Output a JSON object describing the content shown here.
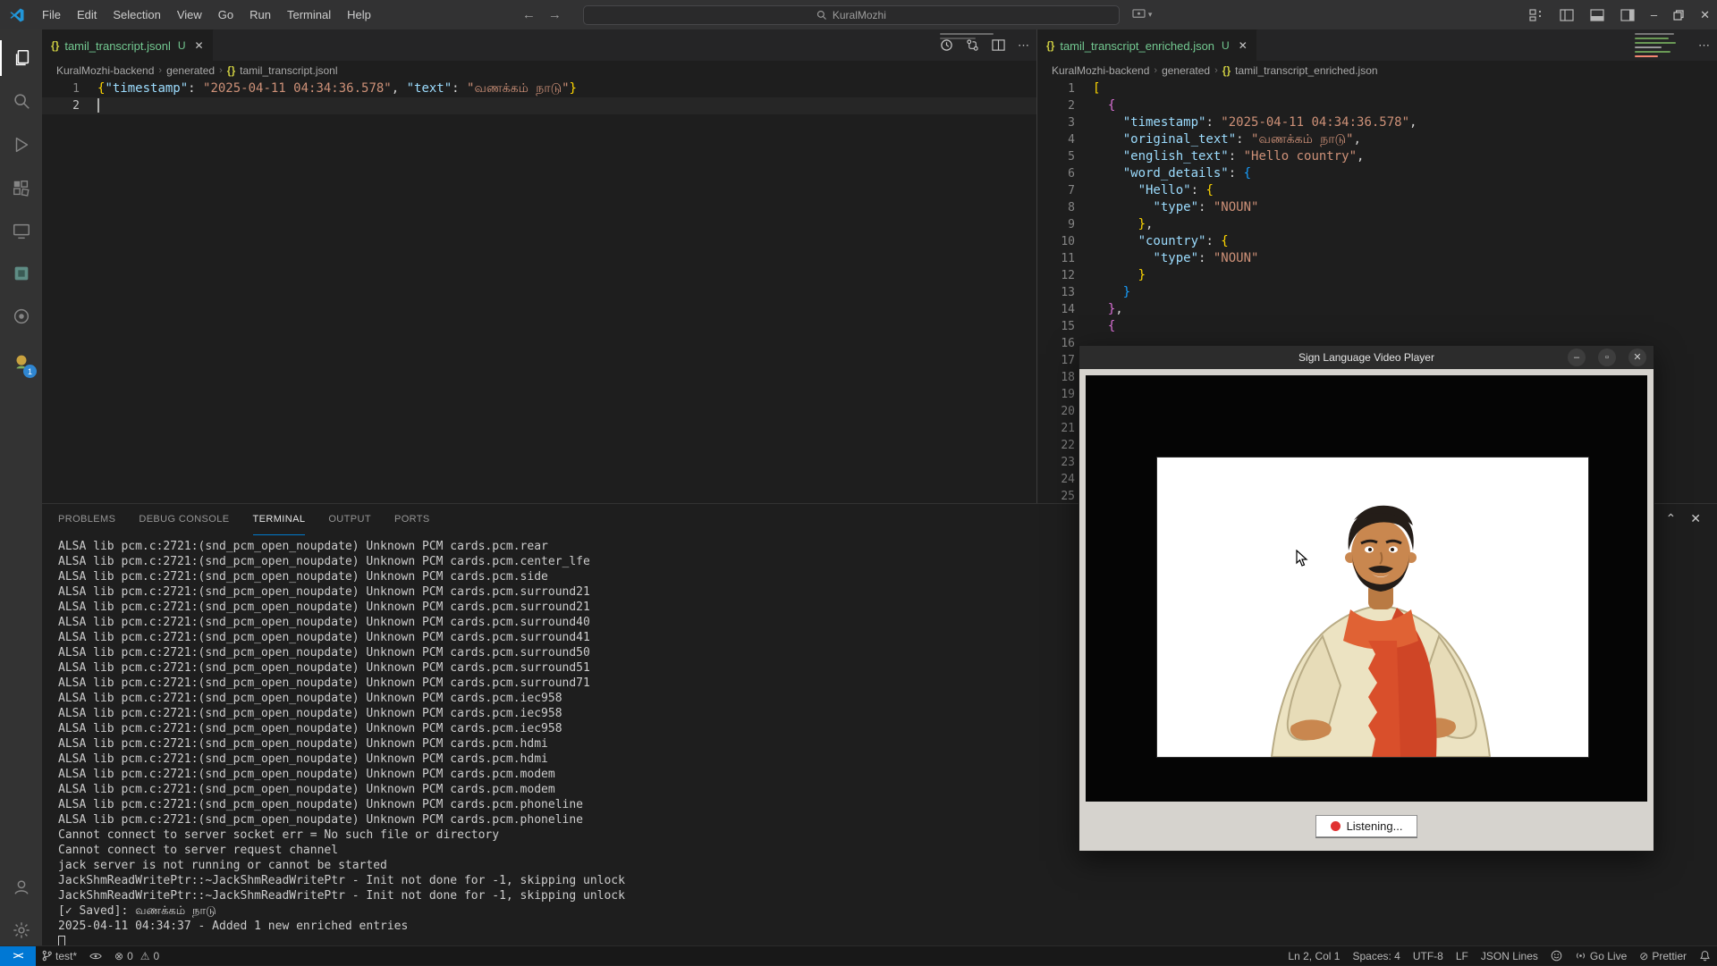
{
  "colors": {
    "accent": "#007acc",
    "untracked_green": "#73c991",
    "badge_blue": "#2f86d1",
    "listening_red": "#e03131",
    "json_icon_yellow": "#cbcb41"
  },
  "titlebar": {
    "menus": [
      "File",
      "Edit",
      "Selection",
      "View",
      "Go",
      "Run",
      "Terminal",
      "Help"
    ],
    "search_value": "KuralMozhi"
  },
  "activity_bar": {
    "badge": "1"
  },
  "editors": {
    "left": {
      "tab_label": "tamil_transcript.jsonl",
      "git_status": "U",
      "close_glyph": "✕",
      "breadcrumb": [
        "KuralMozhi-backend",
        "generated",
        "tamil_transcript.jsonl"
      ],
      "total_lines": 2,
      "cursor_line": 2,
      "lines": {
        "1": [
          [
            "b1",
            "{"
          ],
          [
            "k",
            "\"timestamp\""
          ],
          [
            "p",
            ": "
          ],
          [
            "s",
            "\"2025-04-11 04:34:36.578\""
          ],
          [
            "p",
            ", "
          ],
          [
            "k",
            "\"text\""
          ],
          [
            "p",
            ": "
          ],
          [
            "s",
            "\"வணக்கம் நாடு\""
          ],
          [
            "b1",
            "}"
          ]
        ]
      }
    },
    "right": {
      "tab_label": "tamil_transcript_enriched.json",
      "git_status": "U",
      "close_glyph": "✕",
      "breadcrumb": [
        "KuralMozhi-backend",
        "generated",
        "tamil_transcript_enriched.json"
      ],
      "total_lines": 25,
      "lines": {
        "1": [
          [
            "b1",
            "["
          ]
        ],
        "2": [
          [
            "p",
            "  "
          ],
          [
            "b2",
            "{"
          ]
        ],
        "3": [
          [
            "p",
            "    "
          ],
          [
            "k",
            "\"timestamp\""
          ],
          [
            "p",
            ": "
          ],
          [
            "s",
            "\"2025-04-11 04:34:36.578\""
          ],
          [
            "p",
            ","
          ]
        ],
        "4": [
          [
            "p",
            "    "
          ],
          [
            "k",
            "\"original_text\""
          ],
          [
            "p",
            ": "
          ],
          [
            "s",
            "\"வணக்கம் நாடு\""
          ],
          [
            "p",
            ","
          ]
        ],
        "5": [
          [
            "p",
            "    "
          ],
          [
            "k",
            "\"english_text\""
          ],
          [
            "p",
            ": "
          ],
          [
            "s",
            "\"Hello country\""
          ],
          [
            "p",
            ","
          ]
        ],
        "6": [
          [
            "p",
            "    "
          ],
          [
            "k",
            "\"word_details\""
          ],
          [
            "p",
            ": "
          ],
          [
            "b3",
            "{"
          ]
        ],
        "7": [
          [
            "p",
            "      "
          ],
          [
            "k",
            "\"Hello\""
          ],
          [
            "p",
            ": "
          ],
          [
            "b1",
            "{"
          ]
        ],
        "8": [
          [
            "p",
            "        "
          ],
          [
            "k",
            "\"type\""
          ],
          [
            "p",
            ": "
          ],
          [
            "s",
            "\"NOUN\""
          ]
        ],
        "9": [
          [
            "p",
            "      "
          ],
          [
            "b1",
            "}"
          ],
          [
            "p",
            ","
          ]
        ],
        "10": [
          [
            "p",
            "      "
          ],
          [
            "k",
            "\"country\""
          ],
          [
            "p",
            ": "
          ],
          [
            "b1",
            "{"
          ]
        ],
        "11": [
          [
            "p",
            "        "
          ],
          [
            "k",
            "\"type\""
          ],
          [
            "p",
            ": "
          ],
          [
            "s",
            "\"NOUN\""
          ]
        ],
        "12": [
          [
            "p",
            "      "
          ],
          [
            "b1",
            "}"
          ]
        ],
        "13": [
          [
            "p",
            "    "
          ],
          [
            "b3",
            "}"
          ]
        ],
        "14": [
          [
            "p",
            "  "
          ],
          [
            "b2",
            "}"
          ],
          [
            "p",
            ","
          ]
        ],
        "15": [
          [
            "p",
            "  "
          ],
          [
            "b2",
            "{"
          ]
        ]
      }
    }
  },
  "panel": {
    "tabs": [
      "PROBLEMS",
      "DEBUG CONSOLE",
      "TERMINAL",
      "OUTPUT",
      "PORTS"
    ],
    "active_tab": "TERMINAL",
    "terminal_lines": [
      "ALSA lib pcm.c:2721:(snd_pcm_open_noupdate) Unknown PCM cards.pcm.rear",
      "ALSA lib pcm.c:2721:(snd_pcm_open_noupdate) Unknown PCM cards.pcm.center_lfe",
      "ALSA lib pcm.c:2721:(snd_pcm_open_noupdate) Unknown PCM cards.pcm.side",
      "ALSA lib pcm.c:2721:(snd_pcm_open_noupdate) Unknown PCM cards.pcm.surround21",
      "ALSA lib pcm.c:2721:(snd_pcm_open_noupdate) Unknown PCM cards.pcm.surround21",
      "ALSA lib pcm.c:2721:(snd_pcm_open_noupdate) Unknown PCM cards.pcm.surround40",
      "ALSA lib pcm.c:2721:(snd_pcm_open_noupdate) Unknown PCM cards.pcm.surround41",
      "ALSA lib pcm.c:2721:(snd_pcm_open_noupdate) Unknown PCM cards.pcm.surround50",
      "ALSA lib pcm.c:2721:(snd_pcm_open_noupdate) Unknown PCM cards.pcm.surround51",
      "ALSA lib pcm.c:2721:(snd_pcm_open_noupdate) Unknown PCM cards.pcm.surround71",
      "ALSA lib pcm.c:2721:(snd_pcm_open_noupdate) Unknown PCM cards.pcm.iec958",
      "ALSA lib pcm.c:2721:(snd_pcm_open_noupdate) Unknown PCM cards.pcm.iec958",
      "ALSA lib pcm.c:2721:(snd_pcm_open_noupdate) Unknown PCM cards.pcm.iec958",
      "ALSA lib pcm.c:2721:(snd_pcm_open_noupdate) Unknown PCM cards.pcm.hdmi",
      "ALSA lib pcm.c:2721:(snd_pcm_open_noupdate) Unknown PCM cards.pcm.hdmi",
      "ALSA lib pcm.c:2721:(snd_pcm_open_noupdate) Unknown PCM cards.pcm.modem",
      "ALSA lib pcm.c:2721:(snd_pcm_open_noupdate) Unknown PCM cards.pcm.modem",
      "ALSA lib pcm.c:2721:(snd_pcm_open_noupdate) Unknown PCM cards.pcm.phoneline",
      "ALSA lib pcm.c:2721:(snd_pcm_open_noupdate) Unknown PCM cards.pcm.phoneline",
      "Cannot connect to server socket err = No such file or directory",
      "Cannot connect to server request channel",
      "jack server is not running or cannot be started",
      "JackShmReadWritePtr::~JackShmReadWritePtr - Init not done for -1, skipping unlock",
      "JackShmReadWritePtr::~JackShmReadWritePtr - Init not done for -1, skipping unlock",
      "[✓ Saved]: வணக்கம் நாடு",
      "2025-04-11 04:34:37 - Added 1 new enriched entries"
    ]
  },
  "status_bar": {
    "branch": "test*",
    "errors": "0",
    "warnings": "0",
    "line_col": "Ln 2, Col 1",
    "spaces": "Spaces: 4",
    "encoding": "UTF-8",
    "eol": "LF",
    "language": "JSON Lines",
    "go_live": "Go Live",
    "prettier": "Prettier"
  },
  "video_player": {
    "title": "Sign Language Video Player",
    "listening_label": "Listening...",
    "controls": {
      "minimize": "–",
      "maximize": "▫",
      "close": "✕"
    }
  }
}
